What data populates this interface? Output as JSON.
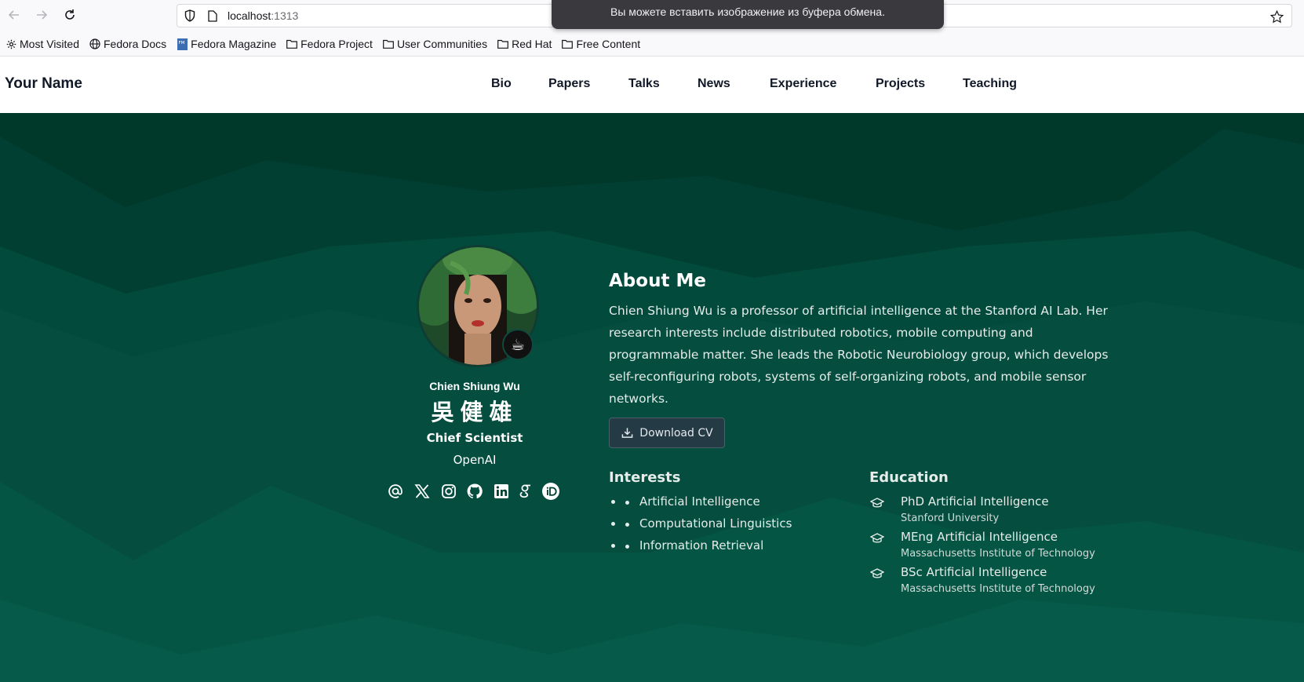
{
  "browser": {
    "url_host": "localhost",
    "url_port": ":1313",
    "toast": "Вы можете вставить изображение из буфера обмена.",
    "bookmarks": [
      {
        "label": "Most Visited",
        "icon": "gear-icon"
      },
      {
        "label": "Fedora Docs",
        "icon": "globe-icon"
      },
      {
        "label": "Fedora Magazine",
        "icon": "fedora-magazine-icon"
      },
      {
        "label": "Fedora Project",
        "icon": "folder-icon"
      },
      {
        "label": "User Communities",
        "icon": "folder-icon"
      },
      {
        "label": "Red Hat",
        "icon": "folder-icon"
      },
      {
        "label": "Free Content",
        "icon": "folder-icon"
      }
    ]
  },
  "header": {
    "brand": "Your Name",
    "nav": [
      "Bio",
      "Papers",
      "Talks",
      "News",
      "Experience",
      "Projects",
      "Teaching"
    ]
  },
  "profile": {
    "name": "Chien Shiung Wu",
    "name_cjk": "吳健雄",
    "role": "Chief Scientist",
    "org": "OpenAI",
    "badge": "☕",
    "socials": [
      "email-icon",
      "x-icon",
      "instagram-icon",
      "github-icon",
      "linkedin-icon",
      "google-scholar-icon",
      "orcid-icon"
    ]
  },
  "about": {
    "title": "About Me",
    "bio": "Chien Shiung Wu is a professor of artificial intelligence at the Stanford AI Lab. Her research interests include distributed robotics, mobile computing and programmable matter. She leads the Robotic Neurobiology group, which develops self-reconfiguring robots, systems of self-organizing robots, and mobile sensor networks.",
    "cv_label": "Download CV"
  },
  "interests": {
    "title": "Interests",
    "items": [
      "Artificial Intelligence",
      "Computational Linguistics",
      "Information Retrieval"
    ]
  },
  "education": {
    "title": "Education",
    "items": [
      {
        "degree": "PhD Artificial Intelligence",
        "institution": "Stanford University"
      },
      {
        "degree": "MEng Artificial Intelligence",
        "institution": "Massachusetts Institute of Technology"
      },
      {
        "degree": "BSc Artificial Intelligence",
        "institution": "Massachusetts Institute of Technology"
      }
    ]
  },
  "colors": {
    "hero_bg": "#00402f",
    "text_light": "#e5ece9",
    "cv_button": "#243b45"
  }
}
